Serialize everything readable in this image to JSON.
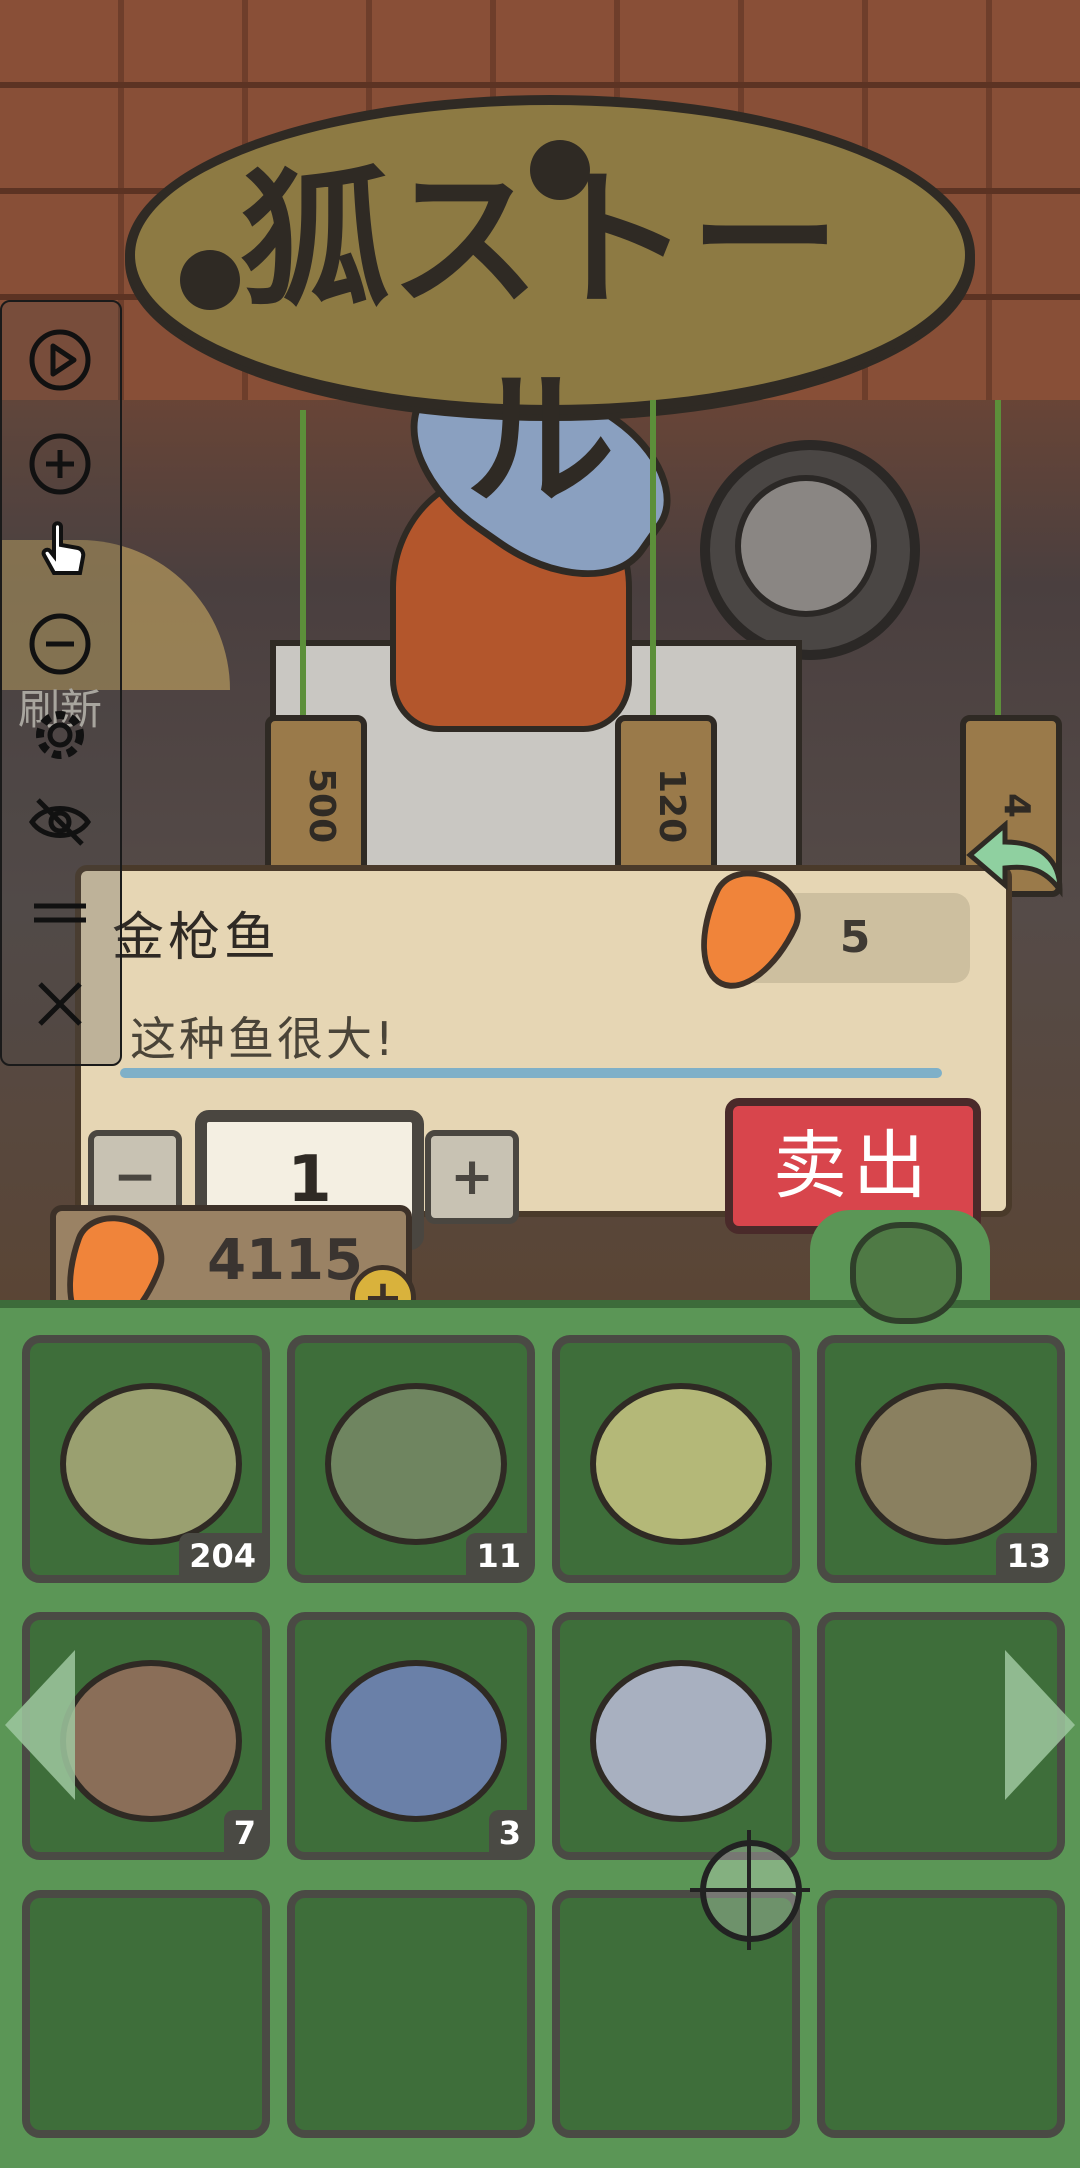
{
  "scene": {
    "sign_text": "狐ストール",
    "tag_prices": [
      "500",
      "120",
      "4"
    ],
    "refresh_label": "刷新"
  },
  "item_panel": {
    "fish_name": "金枪鱼",
    "price": "5",
    "description": "这种鱼很大!",
    "quantity": "1",
    "minus_label": "−",
    "plus_label": "+",
    "sell_label": "卖出"
  },
  "currency": {
    "carrots": "4115",
    "add_label": "+"
  },
  "inventory": {
    "slots": [
      {
        "fish": "catfish",
        "count": "204",
        "color": "#9aa070"
      },
      {
        "fish": "bass",
        "count": "11",
        "color": "#6f8560"
      },
      {
        "fish": "pufferfish",
        "count": "",
        "color": "#b4b878"
      },
      {
        "fish": "carp",
        "count": "13",
        "color": "#8a8060"
      },
      {
        "fish": "flounder",
        "count": "7",
        "color": "#8a6e58"
      },
      {
        "fish": "tuna",
        "count": "3",
        "color": "#6a80a8"
      },
      {
        "fish": "triggerfish",
        "count": "",
        "color": "#a8b0c0"
      },
      {
        "fish": "",
        "count": "",
        "color": ""
      },
      {
        "fish": "",
        "count": "",
        "color": ""
      },
      {
        "fish": "",
        "count": "",
        "color": ""
      },
      {
        "fish": "",
        "count": "",
        "color": ""
      },
      {
        "fish": "",
        "count": "",
        "color": ""
      }
    ]
  },
  "toolbar": {
    "icons": [
      "play-icon",
      "zoom-in-icon",
      "touch-icon",
      "zoom-out-icon",
      "settings-icon",
      "hide-icon",
      "menu-icon",
      "close-icon"
    ]
  },
  "colors": {
    "sell_button": "#d8454c",
    "inventory_bg": "#5b9656",
    "panel_bg": "#e6d6b4"
  }
}
